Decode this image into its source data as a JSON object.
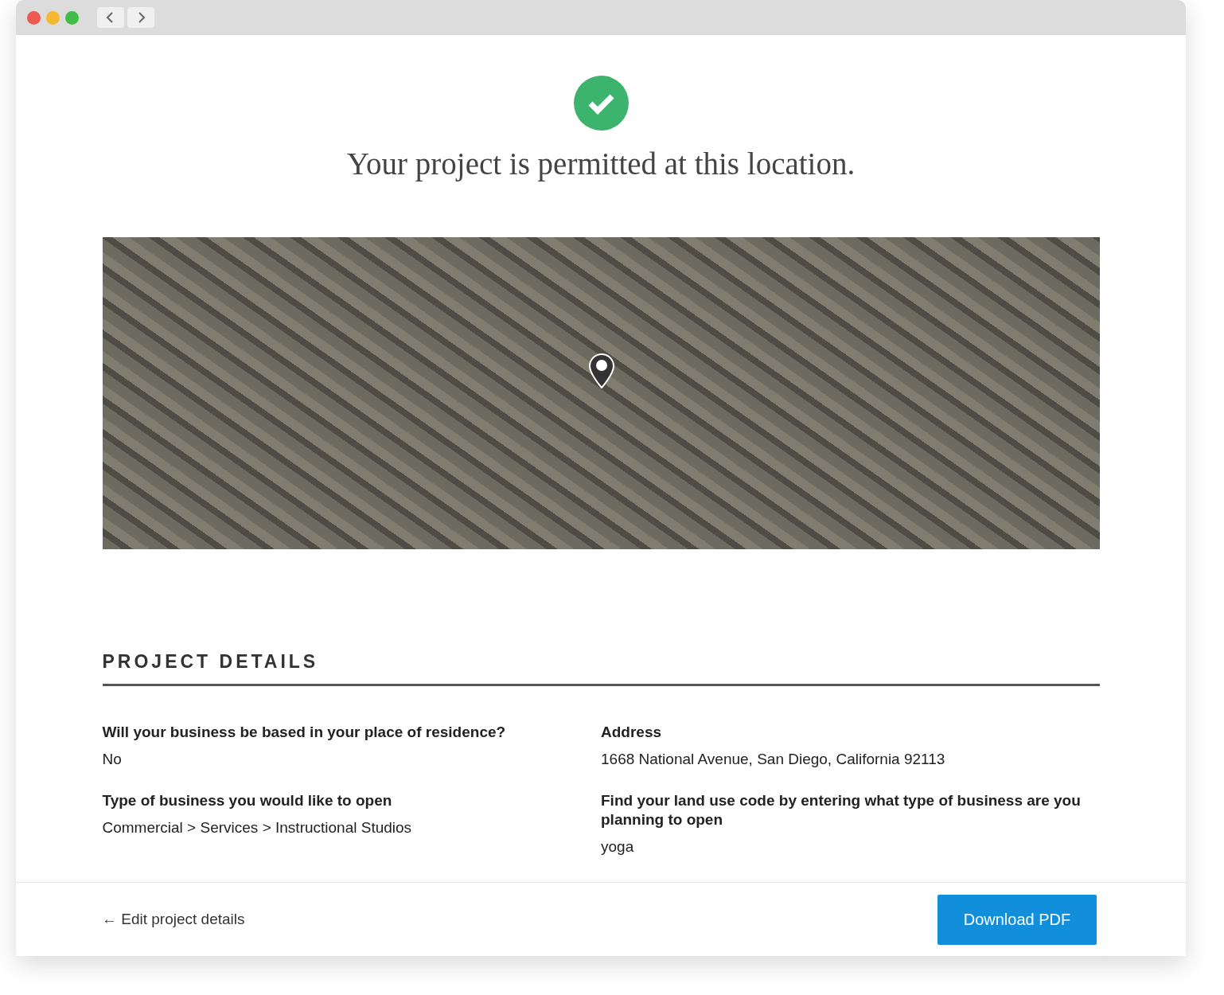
{
  "result": {
    "message": "Your project is permitted at this location."
  },
  "section_title": "PROJECT DETAILS",
  "details": [
    {
      "label": "Will your business be based in your place of residence?",
      "value": "No"
    },
    {
      "label": "Address",
      "value": "1668 National Avenue, San Diego, California 92113"
    },
    {
      "label": "Type of business you would like to open",
      "value": "Commercial > Services > Instructional Studios"
    },
    {
      "label": "Find your land use code by entering what type of business are you planning to open",
      "value": "yoga"
    }
  ],
  "footer": {
    "back_link": "← Edit project details",
    "download_button": "Download PDF"
  }
}
